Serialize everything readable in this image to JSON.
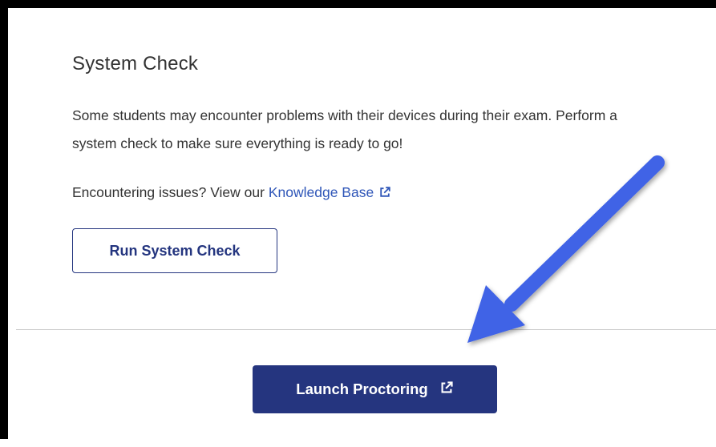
{
  "system_check": {
    "title": "System Check",
    "description": "Some students may encounter problems with their devices during their exam. Perform a system check to make sure everything is ready to go!",
    "help_prefix": "Encountering issues? View our",
    "help_link_label": "Knowledge Base",
    "run_button_label": "Run System Check"
  },
  "footer": {
    "launch_button_label": "Launch Proctoring"
  },
  "icons": {
    "external_link": "external-link-icon",
    "annotation": "arrow-icon"
  },
  "colors": {
    "primary": "#25357f",
    "link": "#2f56b8",
    "annotation_arrow": "#3f63e6",
    "text": "#333333",
    "divider": "#c9c9c9"
  }
}
